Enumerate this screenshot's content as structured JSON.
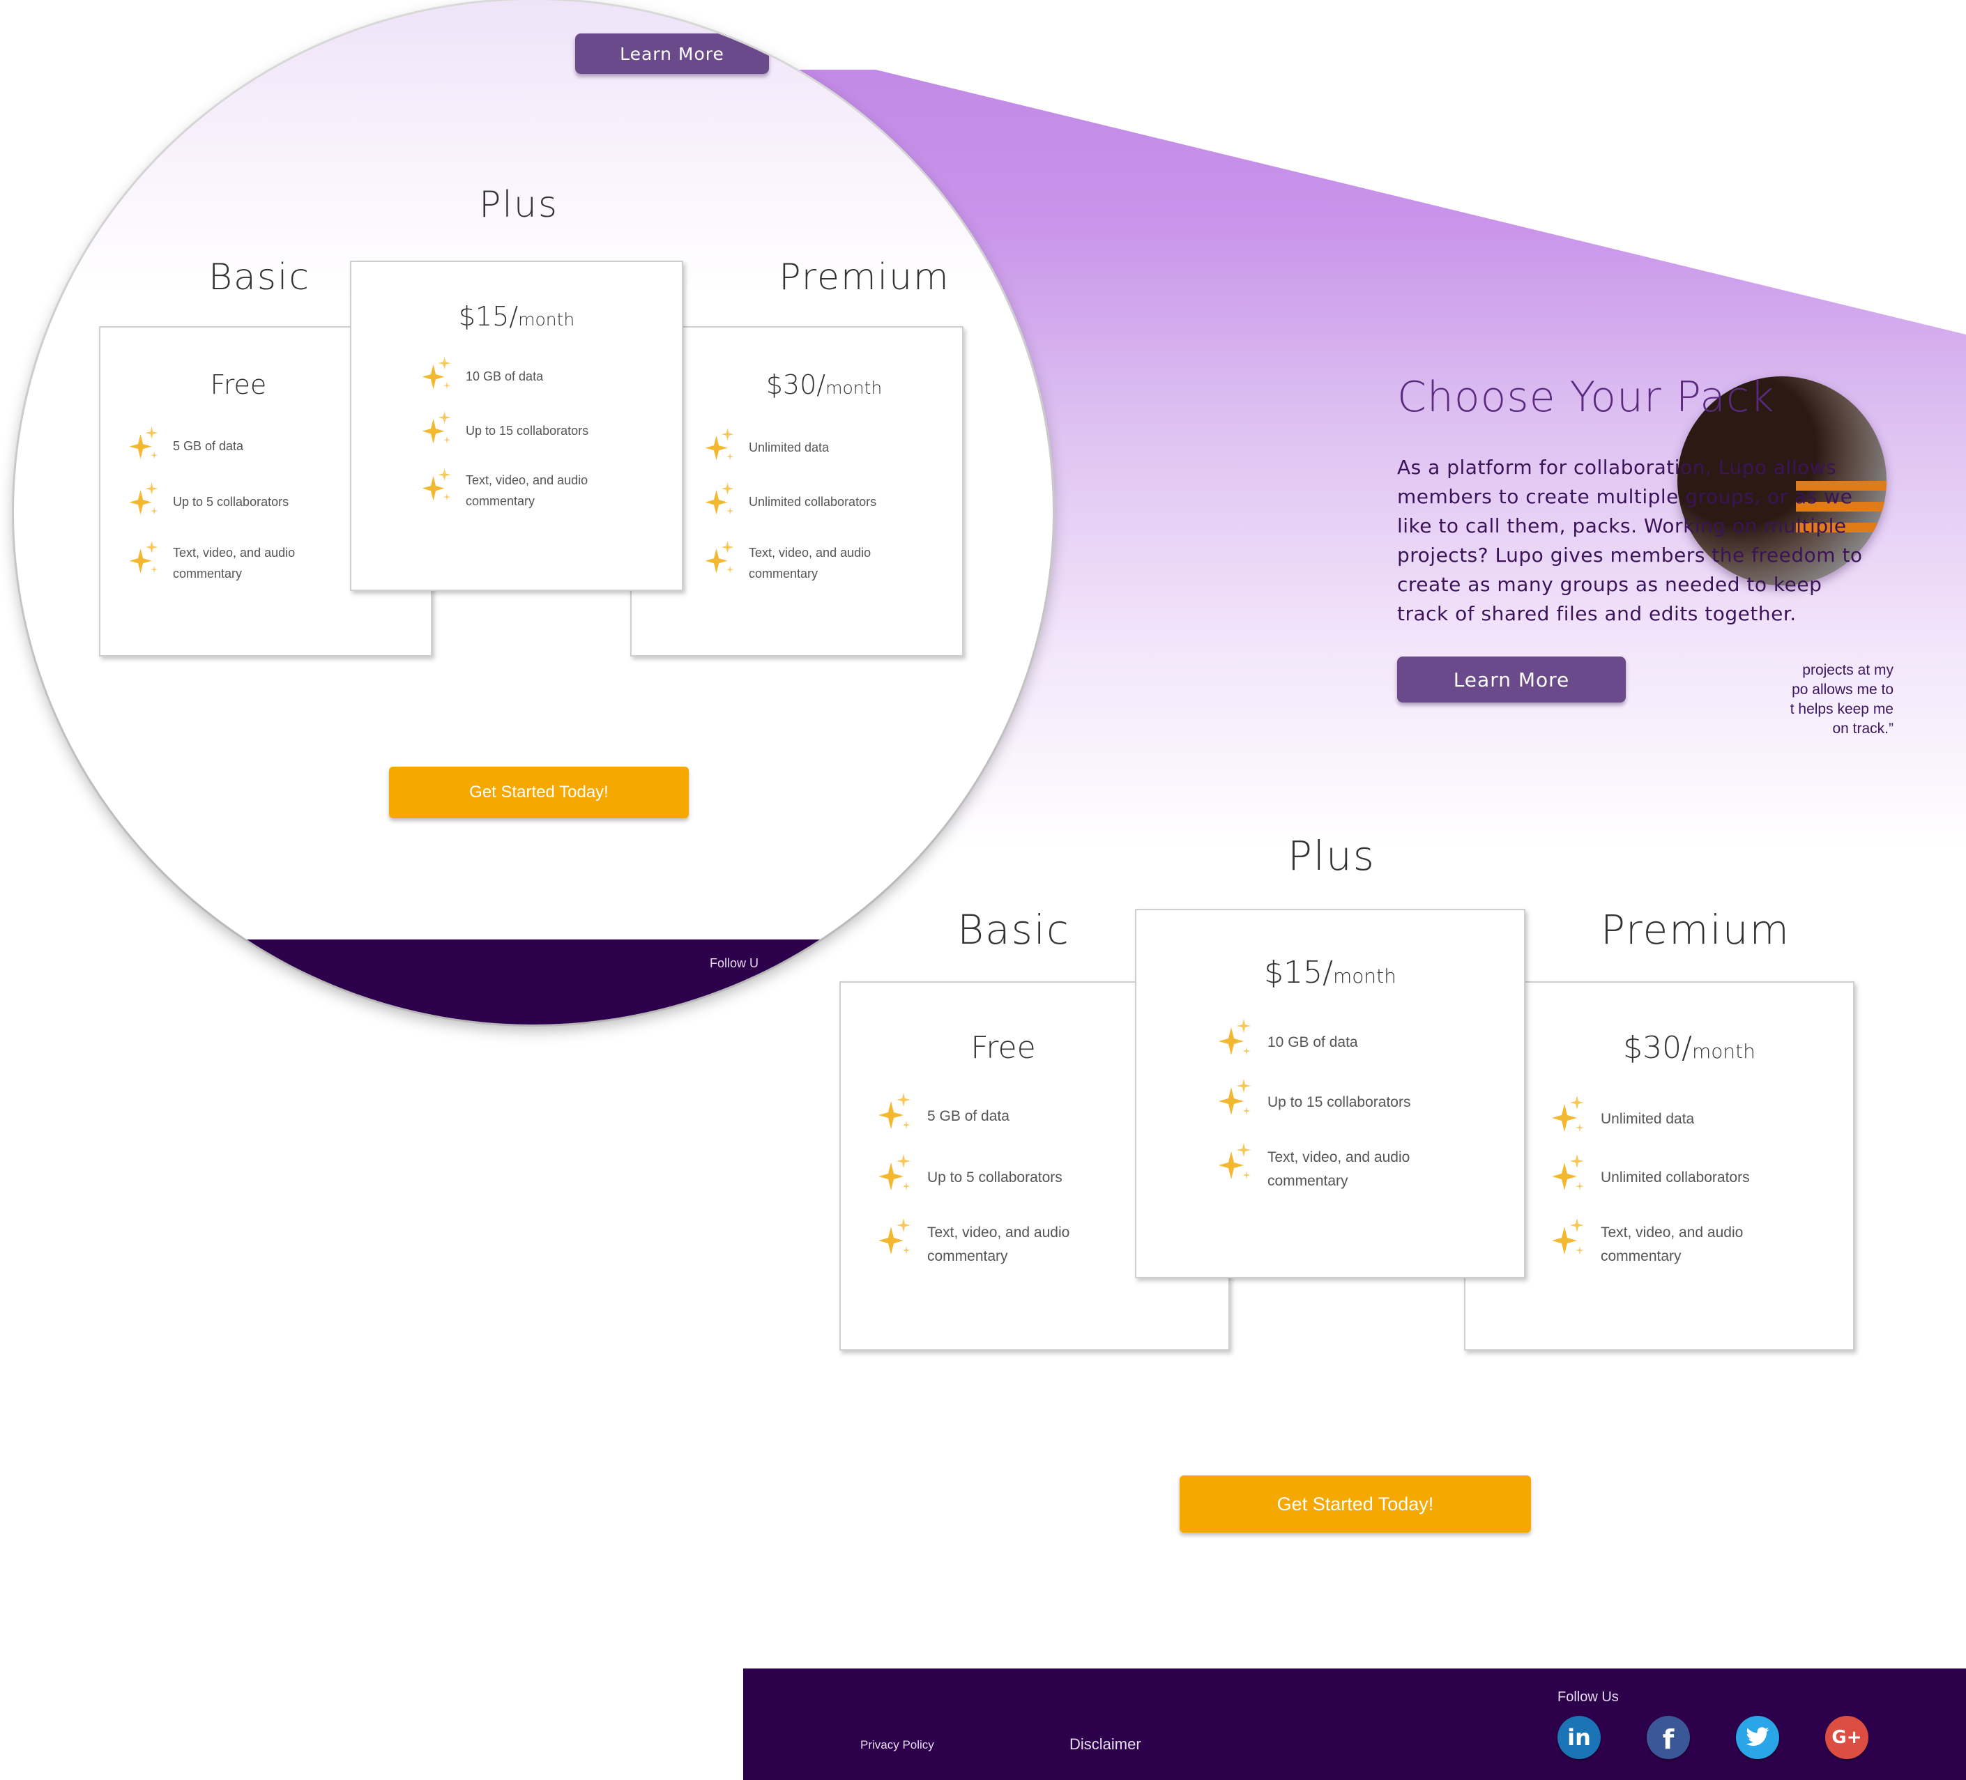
{
  "hero": {
    "title": "Choose Your Pack",
    "description": "As a platform for collaboration, Lupo allows members to create multiple groups, or as we like to call them, packs. Working on multiple projects? Lupo gives members the freedom to create as many groups as needed to keep track of shared files and edits together.",
    "learn_more": "Learn More",
    "quote_lines": [
      "projects at my",
      "po allows me to",
      "t helps keep me",
      "on track.”"
    ]
  },
  "plans": [
    {
      "name": "Basic",
      "price": "Free",
      "per": "",
      "features": [
        [
          "5 GB of data"
        ],
        [
          "Up to 5 collaborators"
        ],
        [
          "Text, video, and audio",
          "commentary"
        ]
      ]
    },
    {
      "name": "Plus",
      "price": "$15/",
      "per": "month",
      "features": [
        [
          "10 GB of data"
        ],
        [
          "Up to 15 collaborators"
        ],
        [
          "Text, video, and audio",
          "commentary"
        ]
      ]
    },
    {
      "name": "Premium",
      "price": "$30/",
      "per": "month",
      "features": [
        [
          "Unlimited data"
        ],
        [
          "Unlimited collaborators"
        ],
        [
          "Text, video, and audio",
          "commentary"
        ]
      ]
    }
  ],
  "cta": {
    "label": "Get Started Today!"
  },
  "footer": {
    "privacy": "Privacy Policy",
    "disclaimer": "Disclaimer",
    "follow": "Follow Us",
    "follow_cut": "Follow U",
    "social": [
      "linkedin-icon",
      "facebook-icon",
      "twitter-icon",
      "google-plus-icon"
    ]
  },
  "colors": {
    "accent_purple": "#6a4a8a",
    "hero_purple": "#c18ae6",
    "cta_orange": "#f5a800",
    "footer_bg": "#2c004a",
    "sparkle": "#f2b830"
  }
}
